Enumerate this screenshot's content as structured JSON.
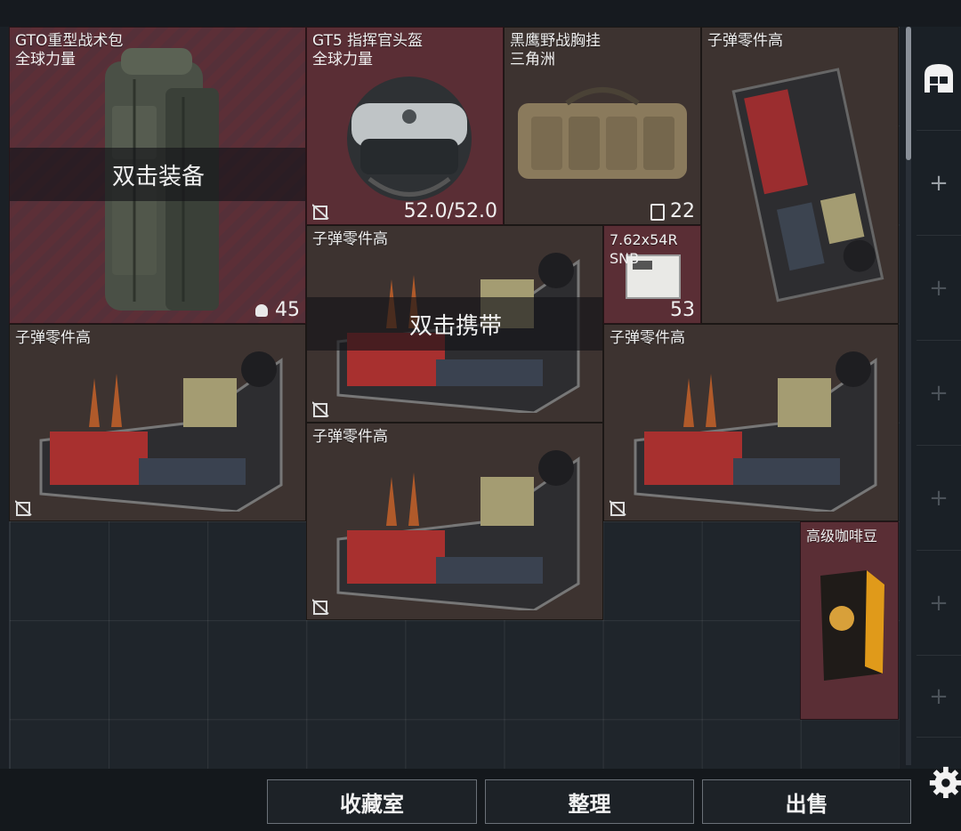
{
  "inventory": {
    "items": [
      {
        "name": "GTO重型战术包",
        "sub": "全球力量",
        "value": "45",
        "value_icon": "helmet-small-icon",
        "overlay": "双击装备"
      },
      {
        "name": "GT5 指挥官头盔",
        "sub": "全球力量",
        "value": "52.0/52.0"
      },
      {
        "name": "黑鹰野战胸挂",
        "sub": "三角洲",
        "value": "22",
        "value_icon": "vest-small-icon"
      },
      {
        "name": "子弹零件高"
      },
      {
        "name": "子弹零件高",
        "overlay": "双击携带"
      },
      {
        "name": "7.62x54R",
        "sub": "SNB",
        "value": "53"
      },
      {
        "name": "子弹零件高"
      },
      {
        "name": "子弹零件高"
      },
      {
        "name": "子弹零件高"
      },
      {
        "name": "高级咖啡豆"
      }
    ]
  },
  "bottom_bar": {
    "buttons": [
      "收藏室",
      "整理",
      "出售"
    ]
  },
  "sidebar": {
    "icons": [
      "storage-icon",
      "plus-icon",
      "plus-icon",
      "plus-icon",
      "plus-icon",
      "plus-icon",
      "plus-icon",
      "plus-icon"
    ],
    "settings_icon": "gear-icon"
  }
}
